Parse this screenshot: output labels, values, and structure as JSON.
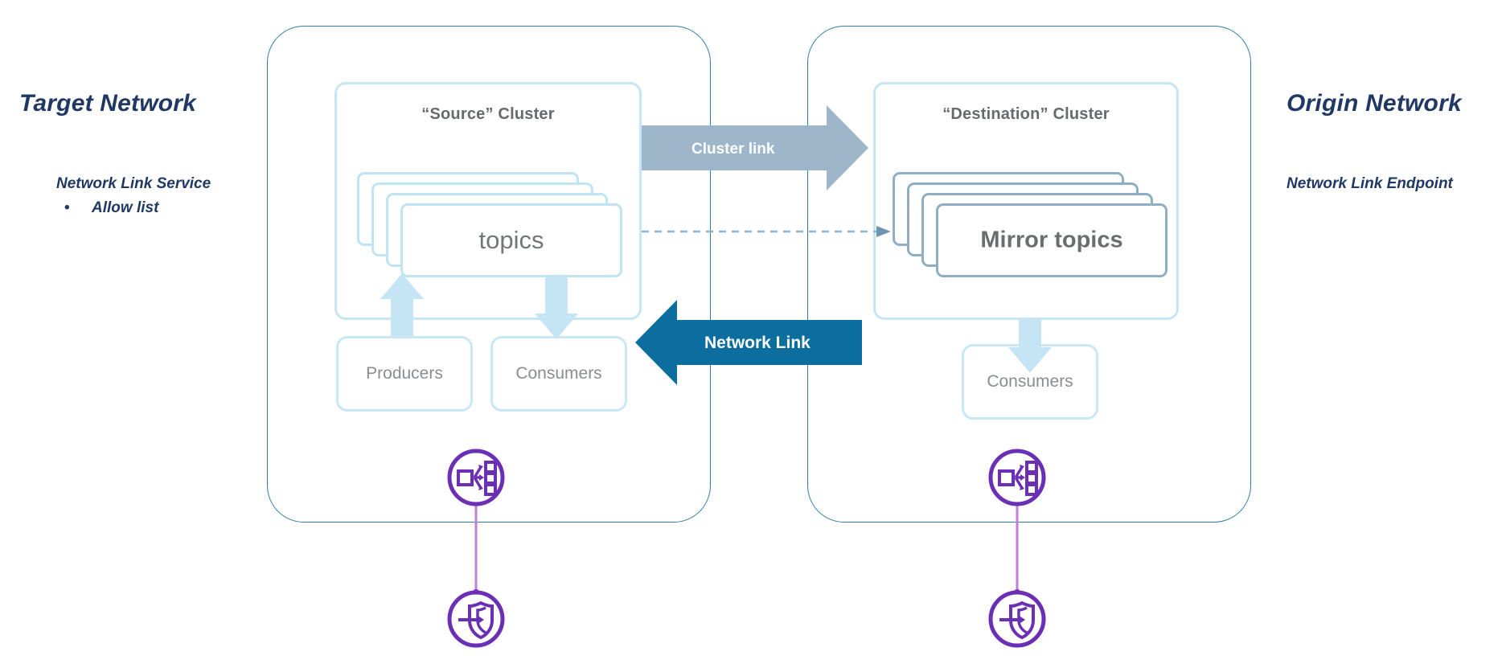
{
  "left_network": {
    "title": "Target Network",
    "subtitle": "Network Link Service",
    "bullet_marker": "•",
    "bullet": "Allow list"
  },
  "right_network": {
    "title": "Origin Network",
    "subtitle": "Network Link Endpoint"
  },
  "source_cluster": {
    "title": "“Source” Cluster",
    "topics_label": "topics",
    "producers_label": "Producers",
    "consumers_label": "Consumers"
  },
  "destination_cluster": {
    "title": "“Destination” Cluster",
    "topics_label": "Mirror topics",
    "consumers_label": "Consumers"
  },
  "connectors": {
    "cluster_link_label": "Cluster link",
    "network_link_label": "Network Link",
    "mirror_flow_label": "topic-mirroring-dashed-arrow"
  },
  "icons": {
    "left_service": "network-load-balancer-icon",
    "left_endpoint": "shield-private-endpoint-icon",
    "right_service": "network-load-balancer-icon",
    "right_endpoint": "shield-private-endpoint-icon"
  },
  "colors": {
    "label_navy": "#1F3864",
    "network_border": "#2E7BA6",
    "cluster_border": "#C7E6F5",
    "card_light_border": "#BFE4F4",
    "card_dark_border": "#8FAEC4",
    "cluster_link_arrow": "#9DB6C9",
    "network_link_arrow": "#0C6E9E",
    "flow_arrow": "#BFE2F2",
    "icon_purple": "#6B2FB5",
    "connector_purple": "#B05BC9",
    "text_grey": "#737679"
  }
}
